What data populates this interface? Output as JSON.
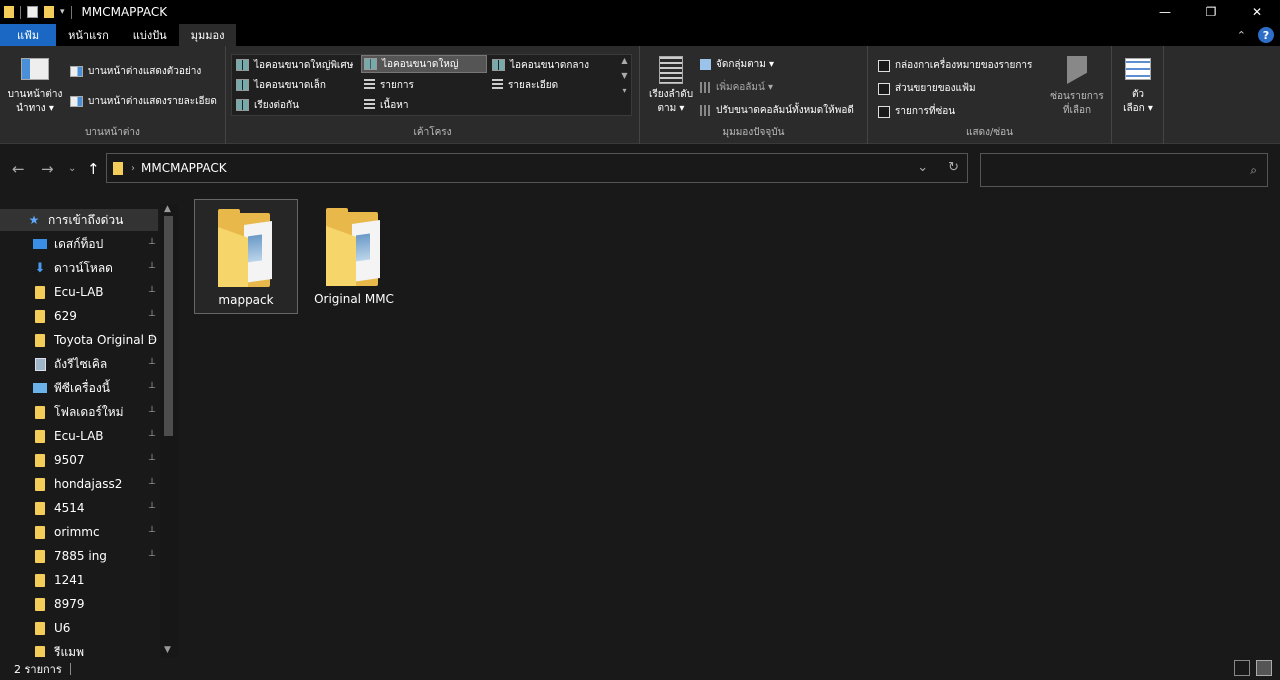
{
  "window": {
    "title": "MMCMAPPACK",
    "controls": {
      "minimize": "—",
      "restore": "❐",
      "close": "✕"
    }
  },
  "ribbon_tabs": [
    {
      "label": "แฟ้ม"
    },
    {
      "label": "หน้าแรก"
    },
    {
      "label": "แบ่งปัน"
    },
    {
      "label": "มุมมอง"
    }
  ],
  "ribbon_right": {
    "collapse": "⌃",
    "help": "?"
  },
  "ribbon": {
    "panes": {
      "nav_pane_label": "บานหน้าต่าง\nนำทาง ▾",
      "preview_pane": "บานหน้าต่างแสดงตัวอย่าง",
      "details_pane": "บานหน้าต่างแสดงรายละเอียด",
      "group_label": "บานหน้าต่าง"
    },
    "layout": {
      "items": [
        "ไอคอนขนาดใหญ่พิเศษ",
        "ไอคอนขนาดใหญ่",
        "ไอคอนขนาดกลาง",
        "ไอคอนขนาดเล็ก",
        "รายการ",
        "รายละเอียด",
        "เรียงต่อกัน",
        "เนื้อหา"
      ],
      "group_label": "เค้าโครง"
    },
    "current_view": {
      "sort_by": "เรียงลำดับ\nตาม ▾",
      "group_by": "จัดกลุ่มตาม ▾",
      "add_columns": "เพิ่มคอลัมน์ ▾",
      "size_columns": "ปรับขนาดคอลัมน์ทั้งหมดให้พอดี",
      "group_label": "มุมมองปัจจุบัน"
    },
    "show_hide": {
      "item_checkboxes": "กล่องกาเครื่องหมายของรายการ",
      "file_extensions": "ส่วนขยายของแฟ้ม",
      "hidden_items": "รายการที่ซ่อน",
      "hide_selected": "ซ่อนรายการ\nที่เลือก",
      "options": "ตัว\nเลือก ▾",
      "group_label": "แสดง/ซ่อน"
    }
  },
  "address": {
    "crumb": "MMCMAPPACK",
    "separator": "›",
    "dropdown": "⌄",
    "refresh": "↻"
  },
  "search": {
    "placeholder": "",
    "icon": "search-icon"
  },
  "nav": {
    "back": "←",
    "forward": "→",
    "recent": "⌄",
    "up": "↑"
  },
  "sidebar": {
    "items": [
      {
        "label": "การเข้าถึงด่วน",
        "icon": "star-icon",
        "pinned": false
      },
      {
        "label": "เดสก์ท็อป",
        "icon": "desktop-icon",
        "pinned": true
      },
      {
        "label": "ดาวน์โหลด",
        "icon": "download-icon",
        "pinned": true
      },
      {
        "label": "Ecu-LAB",
        "icon": "folder-icon",
        "pinned": true
      },
      {
        "label": "629",
        "icon": "folder-icon",
        "pinned": true
      },
      {
        "label": "Toyota Original D",
        "icon": "folder-icon",
        "pinned": true
      },
      {
        "label": "ถังรีไซเคิล",
        "icon": "recycle-bin-icon",
        "pinned": true
      },
      {
        "label": "พีซีเครื่องนี้",
        "icon": "pc-icon",
        "pinned": true
      },
      {
        "label": "โฟลเดอร์ใหม่",
        "icon": "folder-icon",
        "pinned": true
      },
      {
        "label": "Ecu-LAB",
        "icon": "folder-icon",
        "pinned": true
      },
      {
        "label": "9507",
        "icon": "folder-icon",
        "pinned": true
      },
      {
        "label": "hondajass2",
        "icon": "folder-icon",
        "pinned": true
      },
      {
        "label": "4514",
        "icon": "folder-icon",
        "pinned": true
      },
      {
        "label": "orimmc",
        "icon": "folder-icon",
        "pinned": true
      },
      {
        "label": "7885 ing",
        "icon": "folder-icon",
        "pinned": true
      },
      {
        "label": "1241",
        "icon": "folder-icon",
        "pinned": false
      },
      {
        "label": "8979",
        "icon": "folder-icon",
        "pinned": false
      },
      {
        "label": "U6",
        "icon": "folder-icon",
        "pinned": false
      },
      {
        "label": "รีแมพ",
        "icon": "folder-icon",
        "pinned": false
      }
    ],
    "pin_glyph": "📌"
  },
  "content": {
    "items": [
      {
        "name": "mappack",
        "selected": true
      },
      {
        "name": "Original MMC",
        "selected": false
      }
    ]
  },
  "status": {
    "count": "2 รายการ"
  },
  "colors": {
    "file_tab": "#1a68c4",
    "folder": "#e8b84a",
    "background": "#191919"
  }
}
